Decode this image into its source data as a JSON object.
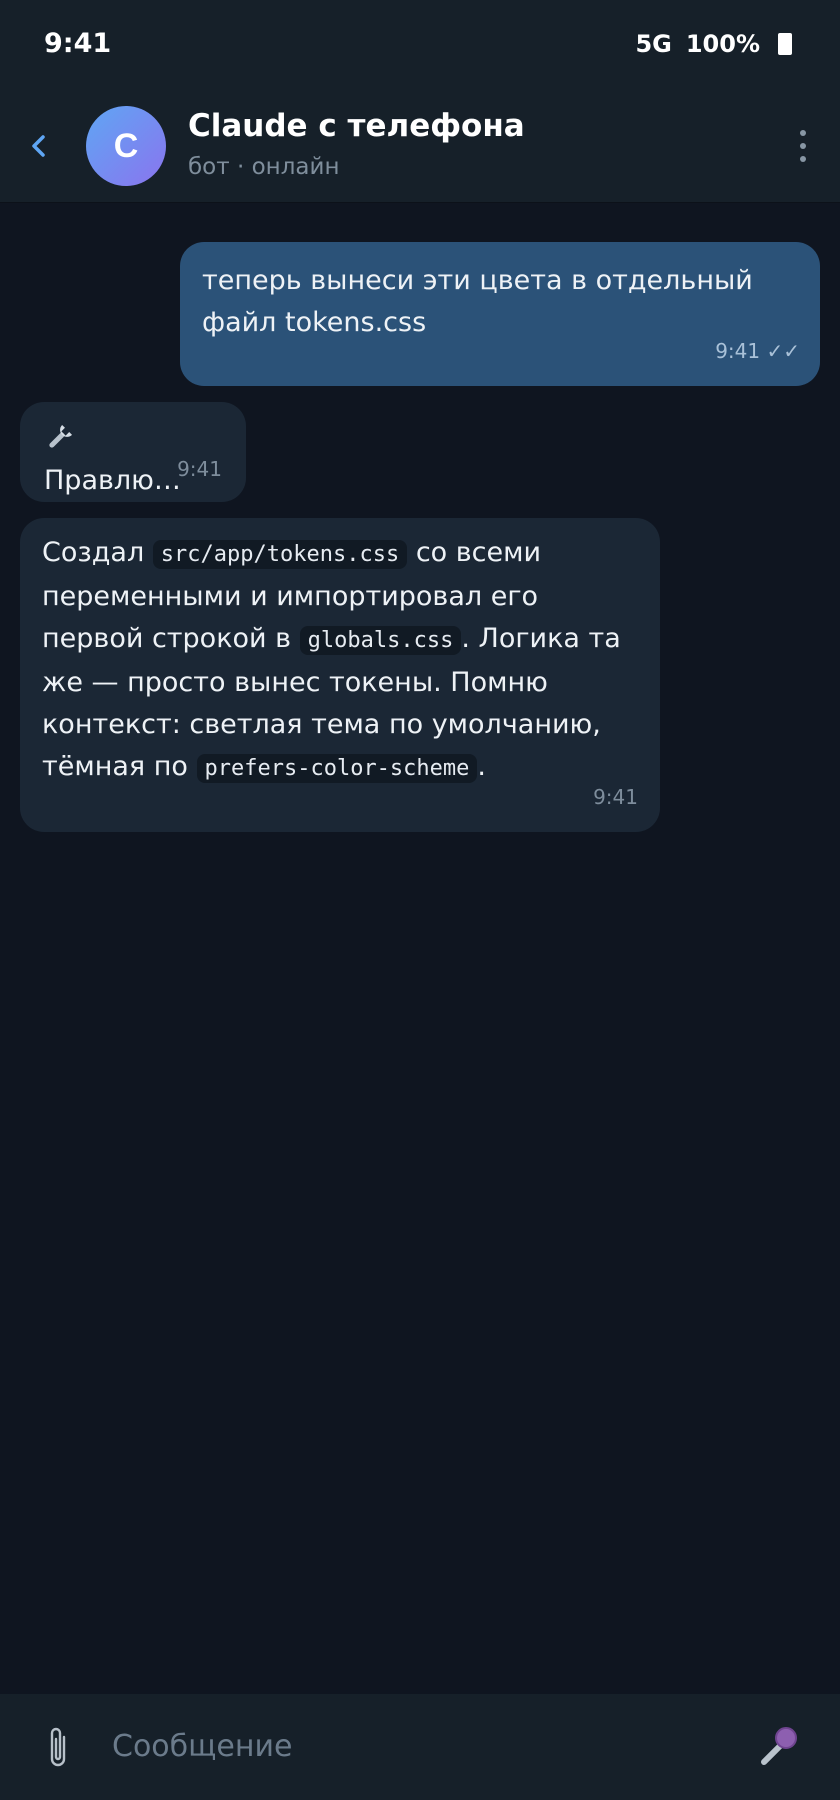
{
  "status_bar": {
    "time": "9:41",
    "network": "5G",
    "battery": "100%"
  },
  "header": {
    "avatar_letter": "C",
    "title": "Claude с телефона",
    "subtitle": "бот · онлайн"
  },
  "messages": [
    {
      "direction": "outgoing",
      "lines": [
        "теперь вынеси эти цвета в отдельный",
        "файл tokens.css"
      ],
      "time": "9:41",
      "ticks": "✓✓"
    },
    {
      "direction": "incoming",
      "text": "Правлю…",
      "icon": "wrench-icon",
      "time": "9:41"
    },
    {
      "direction": "incoming",
      "segments": {
        "t1": "Создал",
        "c1": "src/app/tokens.css",
        "t2": "со всеми",
        "t3": "переменными и импортировал его",
        "t4": "первой строкой в",
        "c2": "globals.css",
        "t5": ". Логика та",
        "t6": "же — просто вынес токены. Помню",
        "t7": "контекст: светлая тема по умолчанию,",
        "t8": "тёмная по",
        "c3": "prefers-color-scheme",
        "t9": "."
      },
      "time": "9:41"
    }
  ],
  "composer": {
    "placeholder": "Сообщение"
  },
  "colors": {
    "outgoing_bubble": "#2b5278",
    "incoming_bubble": "#1b2735",
    "background": "#0f1520",
    "header": "#162029",
    "accent": "#5fa6f4"
  }
}
